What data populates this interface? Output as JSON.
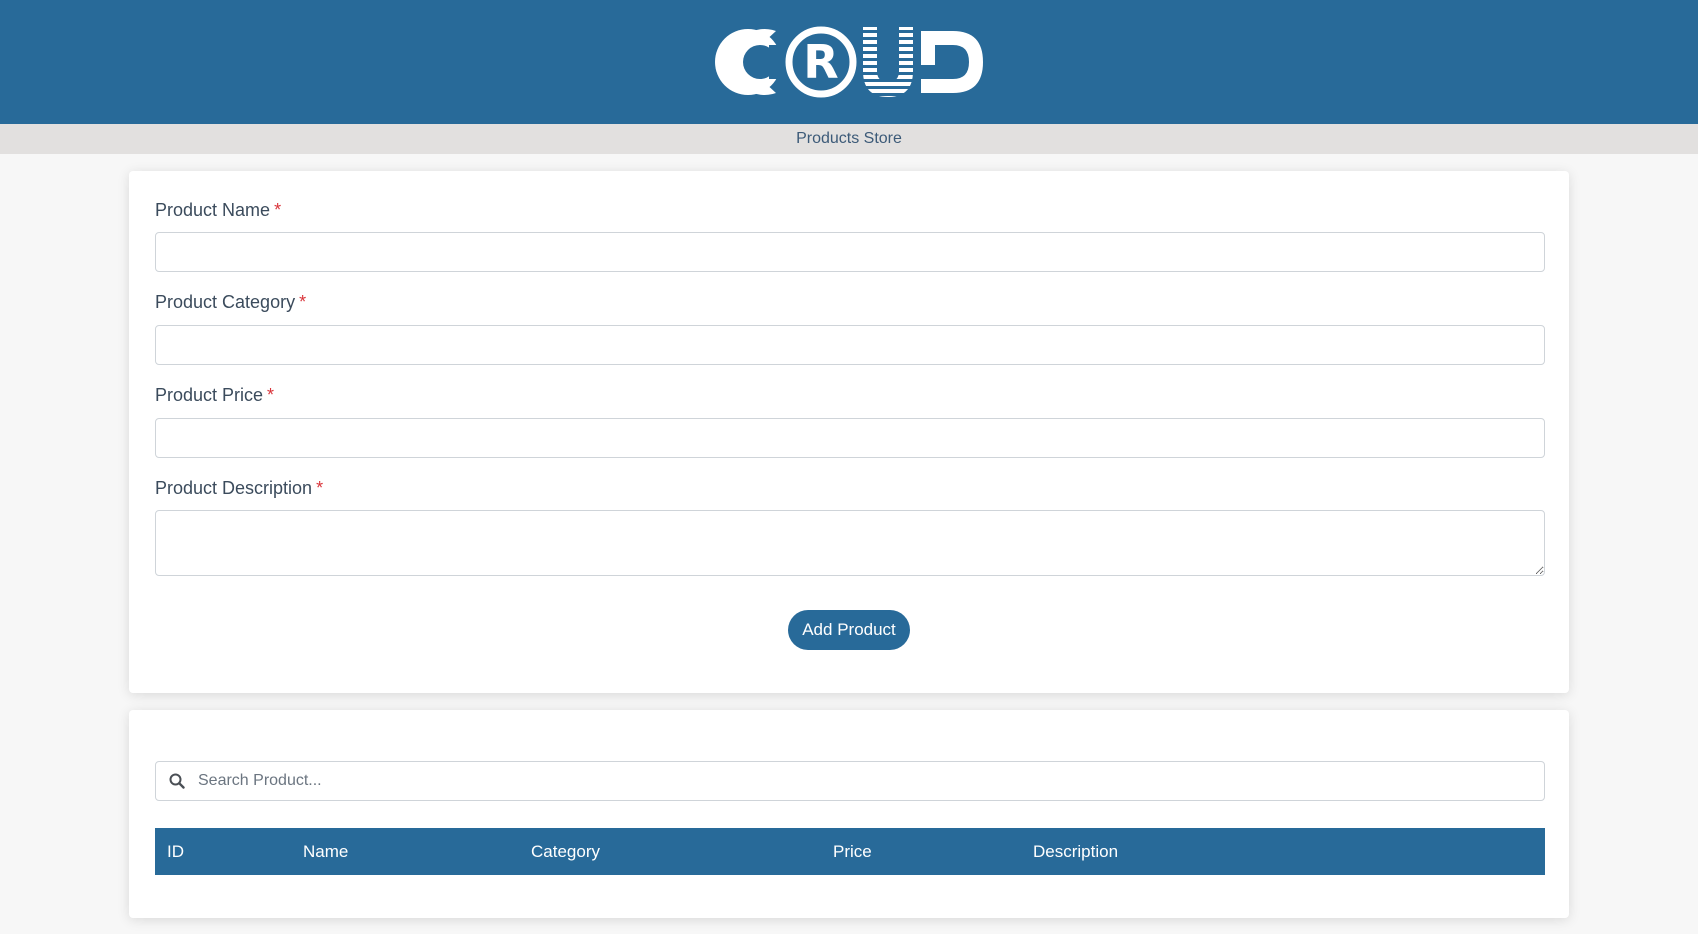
{
  "header": {
    "logo_text": "CRUD",
    "brand_color": "#286a99"
  },
  "subbar": {
    "title": "Products Store"
  },
  "form": {
    "fields": [
      {
        "label": "Product Name",
        "required_mark": "*",
        "value": ""
      },
      {
        "label": "Product Category",
        "required_mark": "*",
        "value": ""
      },
      {
        "label": "Product Price",
        "required_mark": "*",
        "value": ""
      },
      {
        "label": "Product Description",
        "required_mark": "*",
        "value": ""
      }
    ],
    "submit_label": "Add Product"
  },
  "list": {
    "search": {
      "placeholder": "Search Product...",
      "value": "",
      "icon": "search-icon"
    },
    "table": {
      "columns": [
        "ID",
        "Name",
        "Category",
        "Price",
        "Description"
      ],
      "rows": []
    }
  }
}
